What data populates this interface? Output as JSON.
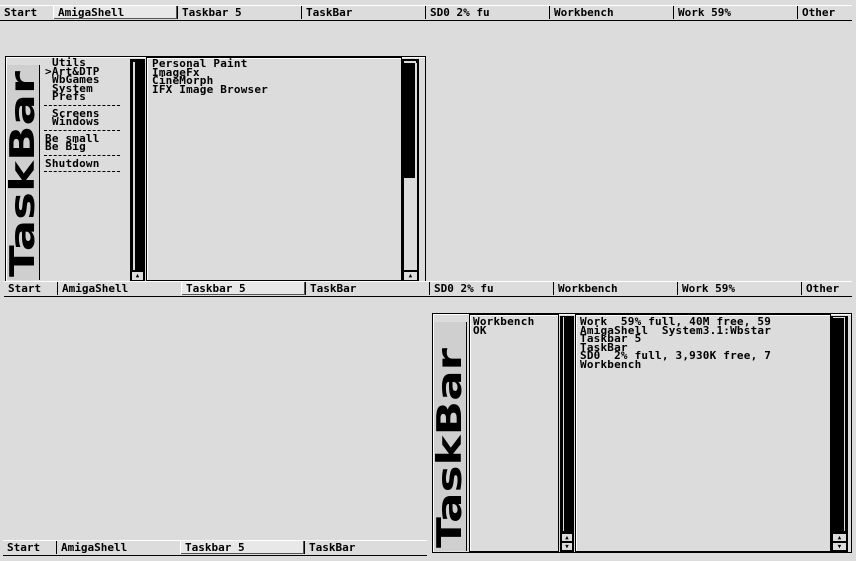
{
  "taskbars": [
    {
      "segments": [
        "Start",
        "AmigaShell",
        "Taskbar 5",
        "TaskBar",
        "SD0  2% fu",
        "Workbench",
        "Work  59%",
        "Other"
      ],
      "active": 1
    },
    {
      "segments": [
        "Start",
        "AmigaShell",
        "Taskbar 5",
        "TaskBar",
        "SD0  2% fu",
        "Workbench",
        "Work  59%",
        "Other"
      ],
      "active": 2
    },
    {
      "segments": [
        "Start",
        "AmigaShell",
        "Taskbar 5",
        "TaskBar"
      ],
      "active": 2
    }
  ],
  "logo_text": "TaskBar",
  "menu_window": {
    "menu": {
      "group1": [
        "Utils",
        ">Art&DTP",
        "WbGames",
        "System",
        "Prefs"
      ],
      "group2": [
        "Screens",
        "Windows"
      ],
      "group3": [
        "Be small",
        "Be Big"
      ],
      "group4": [
        "Shutdown"
      ]
    },
    "submenu": [
      "Personal Paint",
      "ImageFx",
      "CineMorph",
      "IFX Image Browser"
    ]
  },
  "info_window": {
    "names": [
      "Workbench",
      "OK"
    ],
    "details": [
      "Work  59% full, 40M free, 59",
      "AmigaShell  System3.1:Wbstar",
      "Taskbar 5",
      "TaskBar",
      "SD0  2% full, 3,930K free, 7",
      "Workbench"
    ]
  },
  "icons": {
    "scroll_up": "up-arrow-icon",
    "scroll_down": "down-arrow-icon"
  }
}
